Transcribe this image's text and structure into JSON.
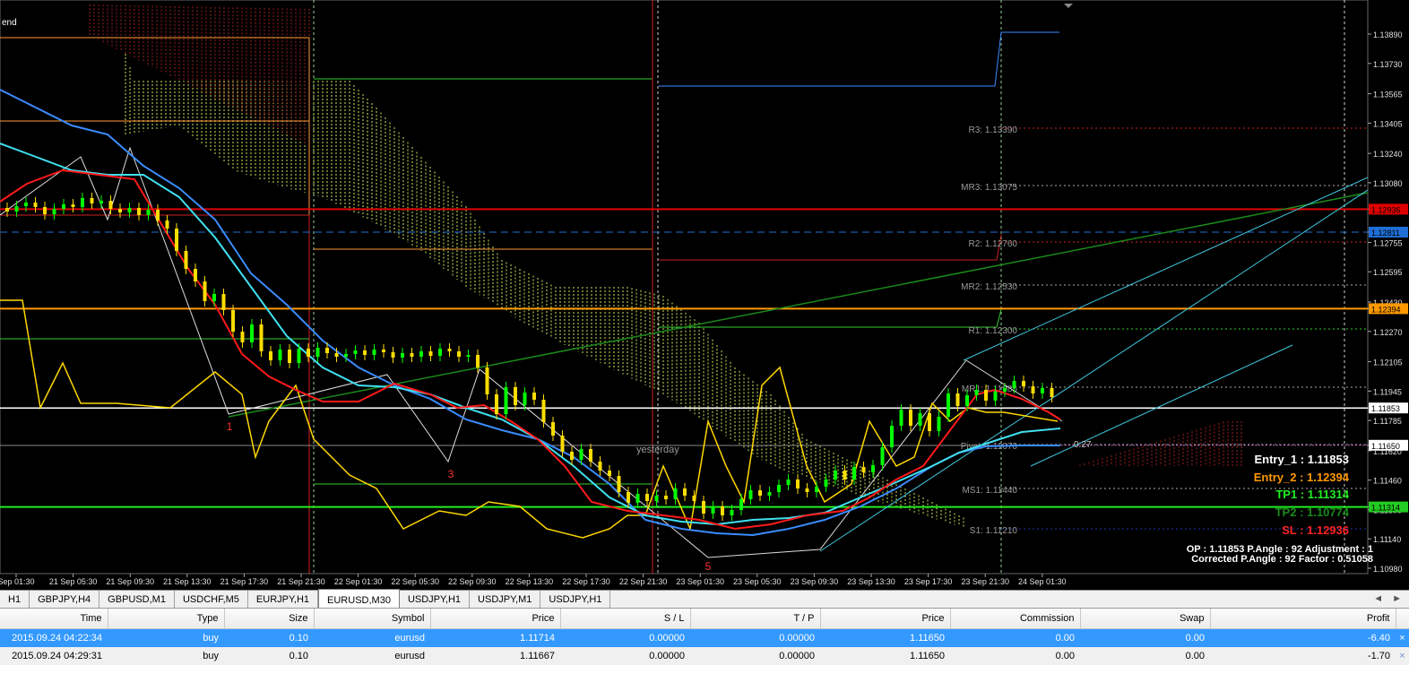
{
  "chart": {
    "indicator_label": "end",
    "price_scale": [
      "1.13890",
      "1.13730",
      "1.13565",
      "1.13405",
      "1.13240",
      "1.13080",
      "1.12936",
      "1.12811",
      "1.12755",
      "1.12595",
      "1.12430",
      "1.12394",
      "1.12270",
      "1.12105",
      "1.11945",
      "1.11853",
      "1.11785",
      "1.11650",
      "1.11620",
      "1.11460",
      "1.11314",
      "1.11300",
      "1.11140",
      "1.10980"
    ],
    "price_tags": [
      {
        "value": "1.12936",
        "color": "#e00000"
      },
      {
        "value": "1.12811",
        "color": "#1f6fd6"
      },
      {
        "value": "1.12394",
        "color": "#ff9900"
      },
      {
        "value": "1.11853",
        "color": "#ffffff"
      },
      {
        "value": "1.11650",
        "color": "#ffffff"
      },
      {
        "value": "1.11314",
        "color": "#22cc22"
      }
    ],
    "time_axis": [
      "Sep 01:30",
      "21 Sep 05:30",
      "21 Sep 09:30",
      "21 Sep 13:30",
      "21 Sep 17:30",
      "21 Sep 21:30",
      "22 Sep 01:30",
      "22 Sep 05:30",
      "22 Sep 09:30",
      "22 Sep 13:30",
      "22 Sep 17:30",
      "22 Sep 21:30",
      "23 Sep 01:30",
      "23 Sep 05:30",
      "23 Sep 09:30",
      "23 Sep 13:30",
      "23 Sep 17:30",
      "23 Sep 21:30",
      "24 Sep 01:30"
    ],
    "pivots": [
      {
        "label": "R3: 1.13390"
      },
      {
        "label": "MR3: 1.13075"
      },
      {
        "label": "R2: 1.12760"
      },
      {
        "label": "MR2: 1.12530"
      },
      {
        "label": "R1: 1.12300"
      },
      {
        "label": "MR1: 1.11985"
      },
      {
        "label": "Pivot: 1.11670"
      },
      {
        "label": "MS1: 1.11440"
      },
      {
        "label": "S1: 1.11210"
      }
    ],
    "yesterday_label": "yesterday",
    "wave_labels": [
      "1",
      "3",
      "5"
    ],
    "countdown": "0:27",
    "info": {
      "entry1": "Entry_1 : 1.11853",
      "entry2": "Entry_2 : 1.12394",
      "tp1": "TP1 : 1.11314",
      "tp2": "TP2 : 1.10774",
      "sl": "SL : 1.12936",
      "op_line": "OP : 1.11853   P.Angle : 92   Adjustment : 1",
      "corr_line": "Corrected P.Angle : 92   Factor : 0.51058"
    },
    "colors": {
      "bull": "#00ff00",
      "bear": "#ffdd00",
      "ma_red": "#ff1a1a",
      "ma_cyan": "#40e0f0",
      "ma_blue": "#3a8cff",
      "osc": "#ffd700"
    }
  },
  "tabs": {
    "items": [
      "H1",
      "GBPJPY,H4",
      "GBPUSD,M1",
      "USDCHF,M5",
      "EURJPY,H1",
      "EURUSD,M30",
      "USDJPY,H1",
      "USDJPY,M1",
      "USDJPY,H1"
    ],
    "active_index": 5,
    "scroll_left": "◄",
    "scroll_right": "►"
  },
  "terminal": {
    "columns": [
      "Time",
      "Type",
      "Size",
      "Symbol",
      "Price",
      "S / L",
      "T / P",
      "Price",
      "Commission",
      "Swap",
      "Profit"
    ],
    "rows": [
      [
        "2015.09.24 04:22:34",
        "buy",
        "0.10",
        "eurusd",
        "1.11714",
        "0.00000",
        "0.00000",
        "1.11650",
        "0.00",
        "0.00",
        "-6.40"
      ],
      [
        "2015.09.24 04:29:31",
        "buy",
        "0.10",
        "eurusd",
        "1.11667",
        "0.00000",
        "0.00000",
        "1.11650",
        "0.00",
        "0.00",
        "-1.70"
      ]
    ],
    "close_glyph": "×"
  }
}
